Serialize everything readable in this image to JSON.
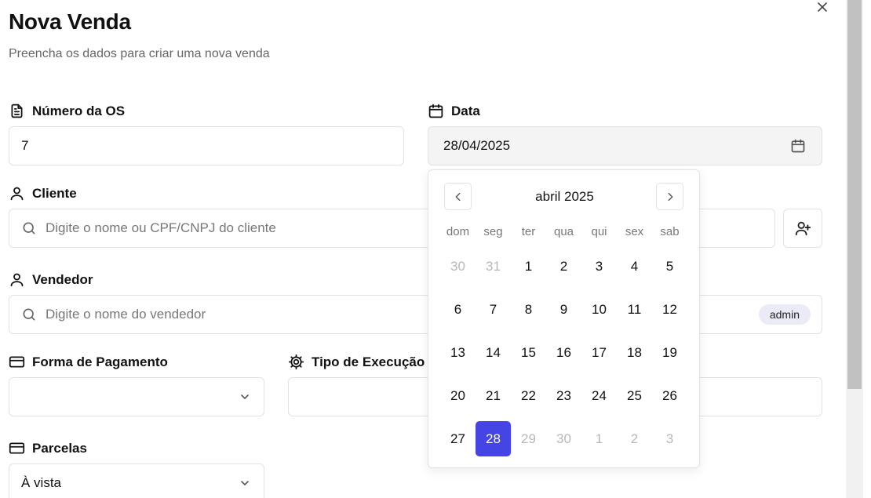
{
  "dialog": {
    "title": "Nova Venda",
    "subtitle": "Preencha os dados para criar uma nova venda",
    "close_icon": "close-icon"
  },
  "fields": {
    "os": {
      "label": "Número da OS",
      "value": "7",
      "icon": "document-icon"
    },
    "data": {
      "label": "Data",
      "value": "28/04/2025",
      "icon": "calendar-icon"
    },
    "cliente": {
      "label": "Cliente",
      "placeholder": "Digite o nome ou CPF/CNPJ do cliente",
      "icon": "user-icon"
    },
    "vendedor": {
      "label": "Vendedor",
      "placeholder": "Digite o nome do vendedor",
      "badge": "admin",
      "icon": "user-icon"
    },
    "pagamento": {
      "label": "Forma de Pagamento",
      "value": "",
      "icon": "credit-card-icon"
    },
    "execucao": {
      "label": "Tipo de Execução",
      "value": "",
      "icon": "gear-icon"
    },
    "parcelas": {
      "label": "Parcelas",
      "value": "À vista",
      "icon": "credit-card-icon"
    }
  },
  "calendar": {
    "month_label": "abril 2025",
    "weekdays": [
      "dom",
      "seg",
      "ter",
      "qua",
      "qui",
      "sex",
      "sab"
    ],
    "weeks": [
      [
        {
          "d": "30",
          "m": true
        },
        {
          "d": "31",
          "m": true
        },
        {
          "d": "1"
        },
        {
          "d": "2"
        },
        {
          "d": "3"
        },
        {
          "d": "4"
        },
        {
          "d": "5"
        }
      ],
      [
        {
          "d": "6"
        },
        {
          "d": "7"
        },
        {
          "d": "8"
        },
        {
          "d": "9"
        },
        {
          "d": "10"
        },
        {
          "d": "11"
        },
        {
          "d": "12"
        }
      ],
      [
        {
          "d": "13"
        },
        {
          "d": "14"
        },
        {
          "d": "15"
        },
        {
          "d": "16"
        },
        {
          "d": "17"
        },
        {
          "d": "18"
        },
        {
          "d": "19"
        }
      ],
      [
        {
          "d": "20"
        },
        {
          "d": "21"
        },
        {
          "d": "22"
        },
        {
          "d": "23"
        },
        {
          "d": "24"
        },
        {
          "d": "25"
        },
        {
          "d": "26"
        }
      ],
      [
        {
          "d": "27"
        },
        {
          "d": "28",
          "s": true
        },
        {
          "d": "29",
          "m": true
        },
        {
          "d": "30",
          "m": true
        },
        {
          "d": "1",
          "m": true
        },
        {
          "d": "2",
          "m": true
        },
        {
          "d": "3",
          "m": true
        }
      ]
    ],
    "selected_color": "#4545e6"
  }
}
